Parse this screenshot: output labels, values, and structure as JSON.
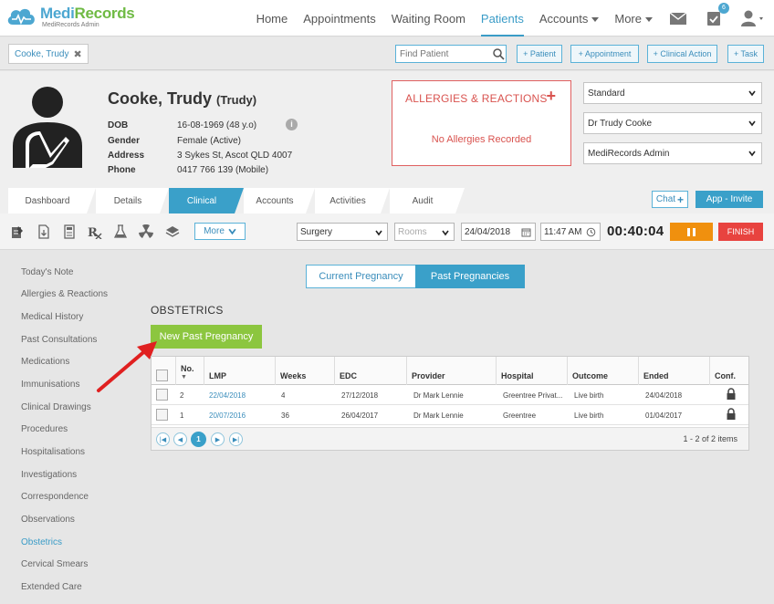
{
  "brand": {
    "name_a": "Medi",
    "name_b": "Records",
    "sub": "MediRecords Admin"
  },
  "nav": {
    "items": [
      "Home",
      "Appointments",
      "Waiting Room",
      "Patients",
      "Accounts",
      "More"
    ],
    "task_badge": "6"
  },
  "toolbar": {
    "patient_tab": "Cooke, Trudy",
    "find_placeholder": "Find Patient",
    "buttons": [
      "+ Patient",
      "+ Appointment",
      "+ Clinical Action",
      "+ Task"
    ]
  },
  "patient": {
    "name": "Cooke, Trudy",
    "nickname": "(Trudy)",
    "fields": [
      {
        "label": "DOB",
        "value": "16-08-1969 (48 y.o)"
      },
      {
        "label": "Gender",
        "value": "Female (Active)"
      },
      {
        "label": "Address",
        "value": "3 Sykes St, Ascot QLD 4007"
      },
      {
        "label": "Phone",
        "value": "0417 766 139 (Mobile)"
      }
    ]
  },
  "allergies": {
    "title": "ALLERGIES & REACTIONS",
    "add": "+",
    "empty": "No Allergies Recorded"
  },
  "selects": [
    "Standard",
    "Dr Trudy Cooke",
    "MediRecords Admin"
  ],
  "tabs": [
    "Dashboard",
    "Details",
    "Clinical",
    "Accounts",
    "Activities",
    "Audit"
  ],
  "tab_actions": {
    "chat": "Chat",
    "invite": "App - Invite"
  },
  "tools": {
    "more": "More",
    "location": "Surgery",
    "rooms": "Rooms",
    "date": "24/04/2018",
    "time": "11:47 AM",
    "timer": "00:40:04",
    "finish": "FINISH"
  },
  "left_menu": {
    "items": [
      "Today's Note",
      "Allergies & Reactions",
      "Medical History",
      "Past Consultations",
      "Medications",
      "Immunisations",
      "Clinical Drawings",
      "Procedures",
      "Hospitalisations",
      "Investigations",
      "Correspondence",
      "Observations",
      "Obstetrics",
      "Cervical Smears",
      "Extended Care"
    ],
    "active": "Obstetrics"
  },
  "pregnancy_tabs": {
    "current": "Current Pregnancy",
    "past": "Past Pregnancies"
  },
  "section": {
    "title": "OBSTETRICS",
    "new_button": "New Past Pregnancy"
  },
  "grid": {
    "columns": [
      "No.",
      "LMP",
      "Weeks",
      "EDC",
      "Provider",
      "Hospital",
      "Outcome",
      "Ended",
      "Conf."
    ],
    "rows": [
      {
        "no": "2",
        "lmp": "22/04/2018",
        "weeks": "4",
        "edc": "27/12/2018",
        "provider": "Dr Mark Lennie",
        "hospital": "Greentree Privat...",
        "outcome": "Live birth",
        "ended": "24/04/2018"
      },
      {
        "no": "1",
        "lmp": "20/07/2016",
        "weeks": "36",
        "edc": "26/04/2017",
        "provider": "Dr Mark Lennie",
        "hospital": "Greentree",
        "outcome": "Live birth",
        "ended": "01/04/2017"
      }
    ],
    "pager": {
      "current_page": "1",
      "info": "1 - 2 of 2 items"
    }
  },
  "colors": {
    "accent": "#3aa0c9",
    "green": "#8cc63f",
    "danger": "#d9534f",
    "pause": "#f0900e"
  }
}
